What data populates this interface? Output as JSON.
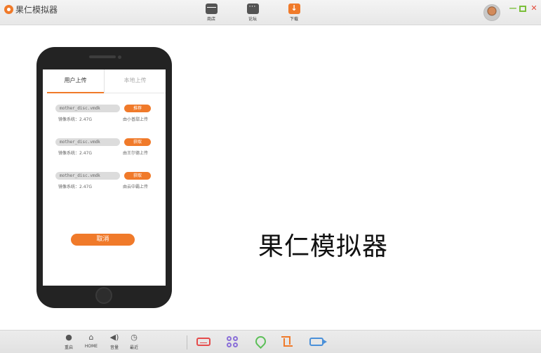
{
  "app": {
    "title": "果仁模拟器"
  },
  "top_tabs": [
    {
      "label": "商店",
      "icon": "store-icon"
    },
    {
      "label": "论坛",
      "icon": "chat-icon"
    },
    {
      "label": "下载",
      "icon": "download-icon",
      "color": "#f07a2a"
    }
  ],
  "phone": {
    "tabs": {
      "user_upload": "用户上传",
      "local_upload": "本地上传"
    },
    "items": [
      {
        "file": "mother_disc.vmdk",
        "action": "推荐",
        "size": "镜像系统：2.47G",
        "uploader": "由小普甜上传"
      },
      {
        "file": "mother_disc.vmdk",
        "action": "获取",
        "size": "镜像系统：2.47G",
        "uploader": "由王尔德上传"
      },
      {
        "file": "mother_disc.vmdk",
        "action": "获取",
        "size": "镜像系统：2.47G",
        "uploader": "由云中霸上传"
      }
    ],
    "cancel_label": "取消"
  },
  "main": {
    "title": "果仁模拟器"
  },
  "bottom_bar": {
    "power_label": "重启",
    "home_label": "HOME",
    "volume_label": "音量",
    "recent_label": "最近"
  },
  "colors": {
    "accent": "#f07a2a",
    "phone_body": "#232323"
  }
}
